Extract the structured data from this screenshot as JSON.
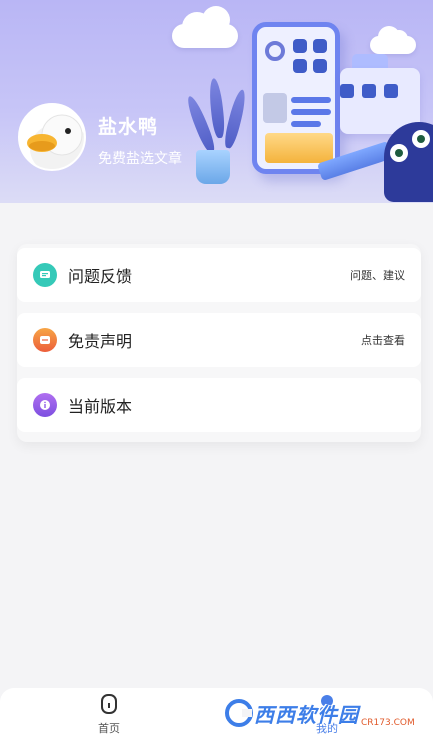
{
  "profile": {
    "name": "盐水鸭",
    "subtitle": "免费盐选文章"
  },
  "menu": {
    "items": [
      {
        "label": "问题反馈",
        "hint": "问题、建议",
        "icon": "feedback-icon",
        "color": "#35c9b8"
      },
      {
        "label": "免责声明",
        "hint": "点击查看",
        "icon": "disclaimer-icon",
        "color": "#f07a3a"
      },
      {
        "label": "当前版本",
        "hint": "",
        "icon": "info-icon",
        "color": "#8f5ce6"
      }
    ]
  },
  "nav": {
    "tabs": [
      {
        "label": "首页",
        "icon": "home-icon",
        "active": false
      },
      {
        "label": "我的",
        "icon": "profile-icon",
        "active": true
      }
    ]
  },
  "watermark": {
    "text": "西西软件园",
    "site": "CR173.COM"
  },
  "colors": {
    "banner": "#bdbaf6",
    "accent": "#3d7ee8"
  }
}
